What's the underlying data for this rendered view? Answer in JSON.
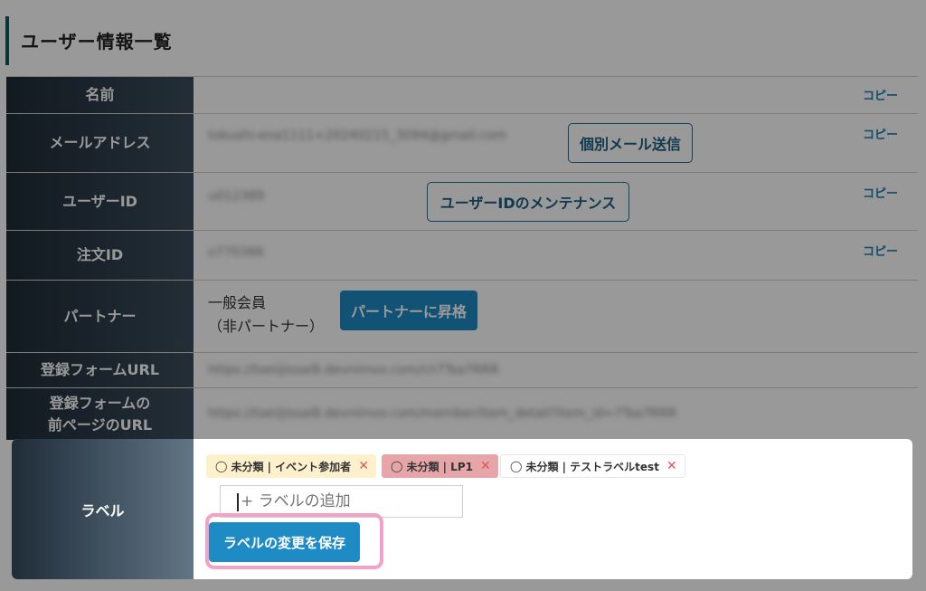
{
  "page": {
    "title": "ユーザー情報一覧"
  },
  "rows": {
    "name": {
      "label": "名前",
      "copy": "コピー"
    },
    "email": {
      "label": "メールアドレス",
      "value": "tokushi-ena1111+20240215_3094@gmail.com",
      "button": "個別メール送信",
      "copy": "コピー"
    },
    "user_id": {
      "label": "ユーザーID",
      "value": "u012389",
      "button": "ユーザーIDのメンテナンス",
      "copy": "コピー"
    },
    "order_id": {
      "label": "注文ID",
      "value": "o770366",
      "copy": "コピー"
    },
    "partner": {
      "label": "パートナー",
      "status_line1": "一般会員",
      "status_line2": "（非パートナー）",
      "button": "パートナーに昇格"
    },
    "form_url": {
      "label": "登録フォームURL",
      "value": "https://toeiijissai8.devnimvo.com/r/r7Tsa7RRR"
    },
    "prev_url": {
      "label_line1": "登録フォームの",
      "label_line2": "前ページのURL",
      "value": "https://toeiijissai8.devnimvo.com/member/item_detail?item_id=7Tsa7RRR"
    },
    "labels": {
      "label": "ラベル",
      "tags": [
        {
          "text": "未分類 | イベント参加者",
          "icon": "tag-icon",
          "color": "#fdf0cc"
        },
        {
          "text": "未分類 | LP1",
          "icon": "tag-icon",
          "color": "#e6a6a9"
        },
        {
          "text": "未分類 | テストラベルtest",
          "icon": "tag-icon",
          "color": "#ffffff"
        }
      ],
      "input_placeholder": "+ ラベルの追加",
      "save_button": "ラベルの変更を保存",
      "remove_icon": "close-icon"
    }
  },
  "colors": {
    "header_bg": "#1f2c38",
    "accent": "#1f8bc4",
    "link": "#1f7fb4",
    "highlight_ring": "#f2a2c6"
  }
}
